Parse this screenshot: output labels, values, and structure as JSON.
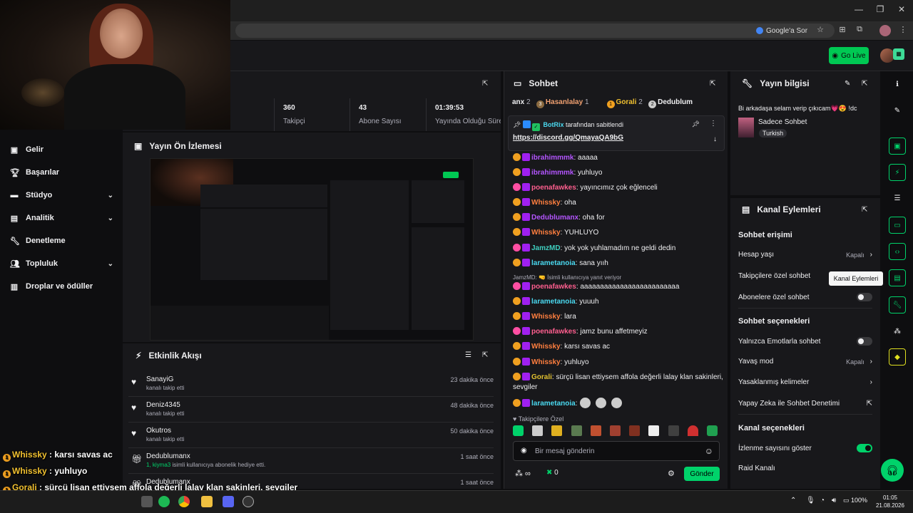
{
  "browser": {
    "search_label": "Google'a Sor",
    "icons": [
      "minimize-icon",
      "maximize-icon",
      "close-icon",
      "star-icon",
      "extensions-icon",
      "profile-icon",
      "menu-icon"
    ]
  },
  "topbar": {
    "go_live": "Go Live"
  },
  "sidebar": {
    "items": [
      {
        "label": "Gelir",
        "icon": "dollar-icon",
        "chevron": false
      },
      {
        "label": "Başarılar",
        "icon": "trophy-icon",
        "chevron": false
      },
      {
        "label": "Stüdyo",
        "icon": "studio-icon",
        "chevron": true
      },
      {
        "label": "Analitik",
        "icon": "analytics-icon",
        "chevron": true
      },
      {
        "label": "Denetleme",
        "icon": "wrench-icon",
        "chevron": false
      },
      {
        "label": "Topluluk",
        "icon": "community-icon",
        "chevron": true
      },
      {
        "label": "Droplar ve ödüller",
        "icon": "drops-icon",
        "chevron": false
      }
    ]
  },
  "stats": [
    {
      "value": "360",
      "label": "Takipçi"
    },
    {
      "value": "43",
      "label": "Abone Sayısı"
    },
    {
      "value": "01:39:53",
      "label": "Yayında Olduğu Süre"
    }
  ],
  "preview": {
    "title": "Yayın Ön İzlemesi"
  },
  "activity": {
    "title": "Etkinlik Akışı",
    "rows": [
      {
        "name": "SanayiG",
        "sub": "kanalı takip etti",
        "time": "23 dakika önce"
      },
      {
        "name": "Deniz4345",
        "sub": "kanalı takip etti",
        "time": "48 dakika önce"
      },
      {
        "name": "Okutros",
        "sub": "kanalı takip etti",
        "time": "50 dakika önce"
      },
      {
        "name": "Dedublumanx",
        "sub_highlight": "1, kiyma3",
        "sub": " isimli kullanıcıya abonelik hediye etti.",
        "time": "1 saat önce"
      },
      {
        "name": "Dedublumanx",
        "sub": "",
        "time": "1 saat önce"
      }
    ]
  },
  "overlay": [
    {
      "user": "Whissky",
      "msg": " : karsı savas ac"
    },
    {
      "user": "Whissky",
      "msg": " : yuhluyo"
    },
    {
      "user": "Gorali",
      "msg": " : sürçü lisan ettiysem affola değerli lalay klan sakinleri, sevgiler"
    },
    {
      "user": "larametanoia",
      "msg": " :"
    }
  ],
  "chat": {
    "title": "Sohbet",
    "top_chatters": [
      {
        "name": "anx",
        "count": "2"
      },
      {
        "name": "Hasanlalay",
        "count": "1",
        "rank": "3"
      },
      {
        "name": "Gorali",
        "count": "2",
        "rank": "1"
      },
      {
        "name": "Dedublum",
        "count": "",
        "rank": "2"
      }
    ],
    "pinned": {
      "by": "BotRix",
      "by_suffix": "tarafından sabitlendi",
      "link": "https://discord.gg/QmayaQA9bG"
    },
    "messages": [
      {
        "user": "ibrahimmmk",
        "cls": "u-pur",
        "text": ": aaaaa"
      },
      {
        "user": "ibrahimmmk",
        "cls": "u-pur",
        "text": ": yuhluyo"
      },
      {
        "user": "poenafawkes",
        "cls": "u-pink",
        "text": ": yayıncımız çok eğlenceli"
      },
      {
        "user": "Whissky",
        "cls": "u-org",
        "text": ": oha"
      },
      {
        "user": "Dedublumanx",
        "cls": "u-pur",
        "text": ": oha for"
      },
      {
        "user": "Whissky",
        "cls": "u-org",
        "text": ": YUHLUYO"
      },
      {
        "user": "JamzMD",
        "cls": "u-teal",
        "text": ": yok yok yuhlamadım ne geldi dedin"
      },
      {
        "user": "larametanoia",
        "cls": "u-cyn",
        "text": ": sana yııh"
      },
      {
        "reply": "JamzMD: 🤜 İsimli kullanıcıya yanıt veriyor"
      },
      {
        "user": "poenafawkes",
        "cls": "u-pink",
        "text": ": aaaaaaaaaaaaaaaaaaaaaaaaa"
      },
      {
        "user": "larametanoia",
        "cls": "u-cyn",
        "text": ": yuuuh"
      },
      {
        "user": "Whissky",
        "cls": "u-org",
        "text": ": lara"
      },
      {
        "user": "poenafawkes",
        "cls": "u-pink",
        "text": ": jamz bunu affetmeyiz"
      },
      {
        "user": "Whissky",
        "cls": "u-org",
        "text": ": karsı savas ac"
      },
      {
        "user": "Whissky",
        "cls": "u-org",
        "text": ": yuhluyo"
      },
      {
        "user": "Gorali",
        "cls": "u-gold",
        "text": ": sürçü lisan ettiysem affola değerli lalay klan sakinleri, sevgiler"
      },
      {
        "user": "larametanoia",
        "cls": "u-cyn",
        "text": ":"
      }
    ],
    "followers_only": "Takipçilere Özel",
    "input_placeholder": "Bir mesaj gönderin",
    "points": "0",
    "send": "Gönder"
  },
  "stream_info": {
    "title": "Yayın bilgisi",
    "stream_title": "Bi arkadaşa selam verip çıkıcam💗😍 !dc",
    "category": "Sadece Sohbet",
    "tag": "Turkish"
  },
  "channel_actions": {
    "title": "Kanal Eylemleri",
    "chat_access": "Sohbet erişimi",
    "account_age": "Hesap yaşı",
    "account_age_val": "Kapalı",
    "followers_chat": "Takipçilere özel sohbet",
    "subs_chat": "Abonelere özel sohbet",
    "chat_options": "Sohbet seçenekleri",
    "emote_only": "Yalnızca Emotlarla sohbet",
    "slow_mode": "Yavaş mod",
    "slow_mode_val": "Kapalı",
    "banned_words": "Yasaklanmış kelimeler",
    "ai_moderation": "Yapay Zeka ile Sohbet Denetimi",
    "channel_options": "Kanal seçenekleri",
    "show_viewers": "İzlenme sayısını göster",
    "raid": "Raid Kanalı",
    "tooltip": "Kanal Eylemleri"
  },
  "taskbar": {
    "battery": "100%",
    "time": "01:05",
    "date": "21.08.2026"
  },
  "colors": {
    "accent": "#00d26a",
    "panel": "#18181b",
    "bg": "#0e0e10"
  }
}
